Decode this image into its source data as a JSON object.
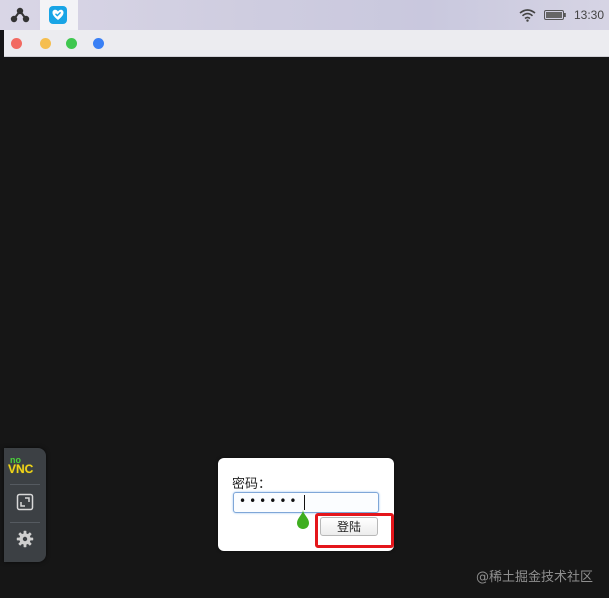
{
  "topbar": {
    "launcher_icon": "launcher-icon",
    "app_icon": "heart-shield-icon",
    "wifi_icon": "wifi-icon",
    "battery_icon": "battery-icon",
    "time": "13:30"
  },
  "window": {
    "traffic_lights": [
      {
        "name": "close",
        "color": "#f26a61"
      },
      {
        "name": "minimize",
        "color": "#f5be4f"
      },
      {
        "name": "maximize",
        "color": "#3fc74f"
      },
      {
        "name": "extra",
        "color": "#3a80f5"
      }
    ]
  },
  "vnc_bar": {
    "logo_no": "no",
    "logo_vnc": "VNC",
    "buttons": [
      "fullscreen-icon",
      "settings-gear-icon"
    ]
  },
  "login": {
    "password_label": "密码：",
    "password_value": "••••••",
    "login_button": "登陆"
  },
  "watermark": "@稀土掘金技术社区",
  "colors": {
    "background": "#161616",
    "highlight": "#e4161b",
    "input_focus": "#7fa7d8",
    "cursor": "#3fae20"
  }
}
